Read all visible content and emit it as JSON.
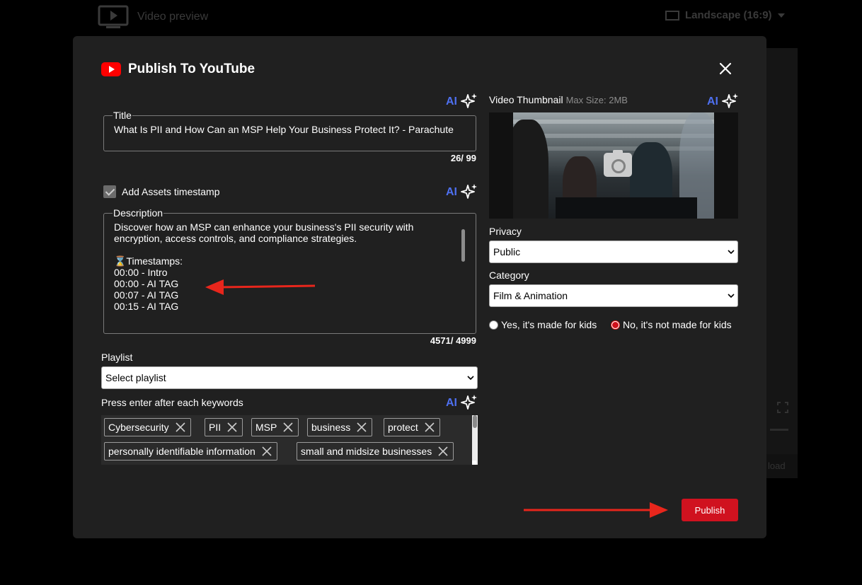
{
  "background": {
    "header_left_label": "Video preview",
    "header_right_label": "Landscape (16:9)",
    "bottom_button_label": "load"
  },
  "modal": {
    "title": "Publish To YouTube",
    "ai_label": "AI",
    "title_field": {
      "legend": "Title",
      "value": "What Is PII and How Can an MSP Help Your Business Protect It? - Parachute",
      "counter": "26/ 99"
    },
    "timestamp_checkbox": {
      "label": "Add Assets timestamp",
      "checked": true
    },
    "description_field": {
      "legend": "Description",
      "value": "Discover how an MSP can enhance your business's PII security with\nencryption, access controls, and compliance strategies.\n\n⌛Timestamps:\n00:00 - Intro\n00:00 - AI TAG\n00:07 - AI TAG\n00:15 - AI TAG",
      "counter": "4571/ 4999"
    },
    "playlist": {
      "label": "Playlist",
      "selected": "Select playlist"
    },
    "keywords": {
      "label": "Press enter after each keywords",
      "tags": [
        "Cybersecurity",
        "PII",
        "MSP",
        "business",
        "protect",
        "personally identifiable information",
        "small and midsize businesses"
      ]
    },
    "thumbnail": {
      "label": "Video Thumbnail",
      "max_size": "Max Size: 2MB"
    },
    "privacy": {
      "label": "Privacy",
      "selected": "Public"
    },
    "category": {
      "label": "Category",
      "selected": "Film & Animation"
    },
    "made_for_kids": {
      "option_yes": "Yes, it's made for kids",
      "option_no": "No, it's not made for kids",
      "selected": "no"
    },
    "publish_button": "Publish"
  },
  "colors": {
    "modal_bg": "#202020",
    "accent_ai": "#4e70f0",
    "publish_red": "#d0121f",
    "annotation_arrow": "#e8261c"
  }
}
